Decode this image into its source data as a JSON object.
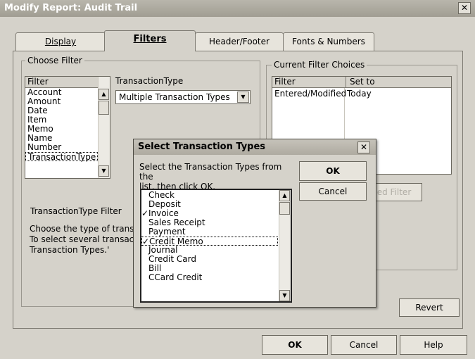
{
  "window": {
    "title": "Modify Report: Audit Trail",
    "close_glyph": "✕"
  },
  "tabs": [
    {
      "label": "Display",
      "active": false
    },
    {
      "label": "Filters",
      "active": true
    },
    {
      "label": "Header/Footer",
      "active": false
    },
    {
      "label": "Fonts & Numbers",
      "active": false
    }
  ],
  "choose_filter": {
    "legend": "Choose Filter",
    "list_header": "Filter",
    "items": [
      "Account",
      "Amount",
      "Date",
      "Item",
      "Memo",
      "Name",
      "Number",
      "TransactionType"
    ],
    "selected": "TransactionType",
    "field_label": "TransactionType",
    "dropdown_value": "Multiple Transaction Types"
  },
  "type_filter": {
    "legend": "TransactionType Filter",
    "desc_line1": "Choose the type of transa",
    "desc_line2": "To select several transacti",
    "desc_line3": "Transaction Types.'"
  },
  "current_filters": {
    "legend": "Current Filter Choices",
    "col_filter": "Filter",
    "col_set_to": "Set to",
    "rows": [
      {
        "filter": "Entered/Modified",
        "set_to": "Today"
      }
    ],
    "remove_button": "ed Filter"
  },
  "buttons": {
    "revert": "Revert",
    "ok": "OK",
    "cancel": "Cancel",
    "help": "Help"
  },
  "popup": {
    "title": "Select Transaction Types",
    "close_glyph": "✕",
    "instruction_line1": "Select the Transaction Types from the",
    "instruction_line2": "list, then click OK.",
    "ok": "OK",
    "cancel": "Cancel",
    "items": [
      {
        "label": "Check",
        "checked": false
      },
      {
        "label": "Deposit",
        "checked": false
      },
      {
        "label": "Invoice",
        "checked": true
      },
      {
        "label": "Sales Receipt",
        "checked": false
      },
      {
        "label": "Payment",
        "checked": false
      },
      {
        "label": "Credit Memo",
        "checked": true
      },
      {
        "label": "Journal",
        "checked": false
      },
      {
        "label": "Credit Card",
        "checked": false
      },
      {
        "label": "Bill",
        "checked": false
      },
      {
        "label": "CCard Credit",
        "checked": false
      }
    ],
    "focused": "Credit Memo",
    "check_glyph": "✓"
  },
  "icons": {
    "scroll_up": "▲",
    "scroll_down": "▼",
    "dropdown": "▼"
  }
}
